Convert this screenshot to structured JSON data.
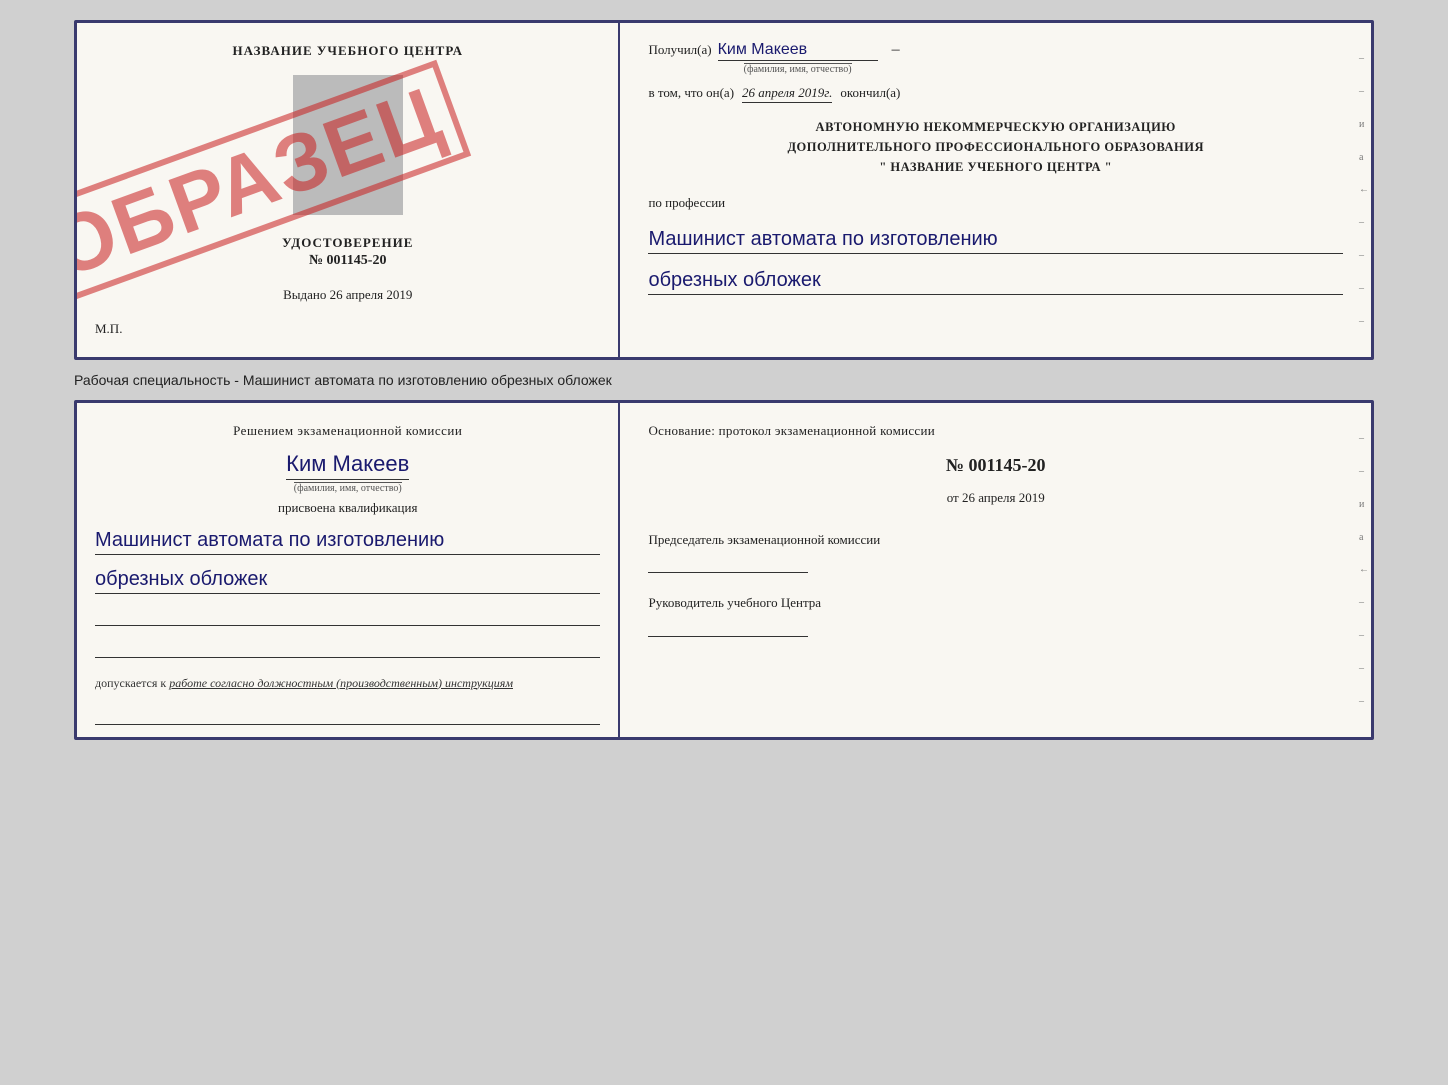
{
  "top_left": {
    "title": "НАЗВАНИЕ УЧЕБНОГО ЦЕНТРА",
    "udostoverenie_label": "УДОСТОВЕРЕНИЕ",
    "number": "№ 001145-20",
    "vydano": "Выдано",
    "vydano_date": "26 апреля 2019",
    "mp": "М.П.",
    "obrazec": "ОБРАЗЕЦ"
  },
  "top_right": {
    "poluchil": "Получил(а)",
    "name": "Ким Макеев",
    "fio_sub": "(фамилия, имя, отчество)",
    "vtom": "в том, что он(а)",
    "date": "26 апреля 2019г.",
    "okonchil": "окончил(а)",
    "org_line1": "АВТОНОМНУЮ НЕКОММЕРЧЕСКУЮ ОРГАНИЗАЦИЮ",
    "org_line2": "ДОПОЛНИТЕЛЬНОГО ПРОФЕССИОНАЛЬНОГО ОБРАЗОВАНИЯ",
    "org_line3": "\"  НАЗВАНИЕ УЧЕБНОГО ЦЕНТРА  \"",
    "po_professii": "по профессии",
    "profession_line1": "Машинист автомата по изготовлению",
    "profession_line2": "обрезных обложек"
  },
  "specialty_text": "Рабочая специальность - Машинист автомата по изготовлению обрезных обложек",
  "bottom_left": {
    "resheniem": "Решением экзаменационной комиссии",
    "name": "Ким Макеев",
    "fio_sub": "(фамилия, имя, отчество)",
    "prisvoyena": "присвоена квалификация",
    "qualification_line1": "Машинист автомата по изготовлению",
    "qualification_line2": "обрезных обложек",
    "dopuskaetsya": "допускается к",
    "dopuskaetsya_italic": "работе согласно должностным (производственным) инструкциям"
  },
  "bottom_right": {
    "osnovaniye": "Основание: протокол экзаменационной комиссии",
    "number": "№  001145-20",
    "ot": "от",
    "date": "26 апреля 2019",
    "chairman_label": "Председатель экзаменационной комиссии",
    "rukvoditel_label": "Руководитель учебного Центра"
  }
}
